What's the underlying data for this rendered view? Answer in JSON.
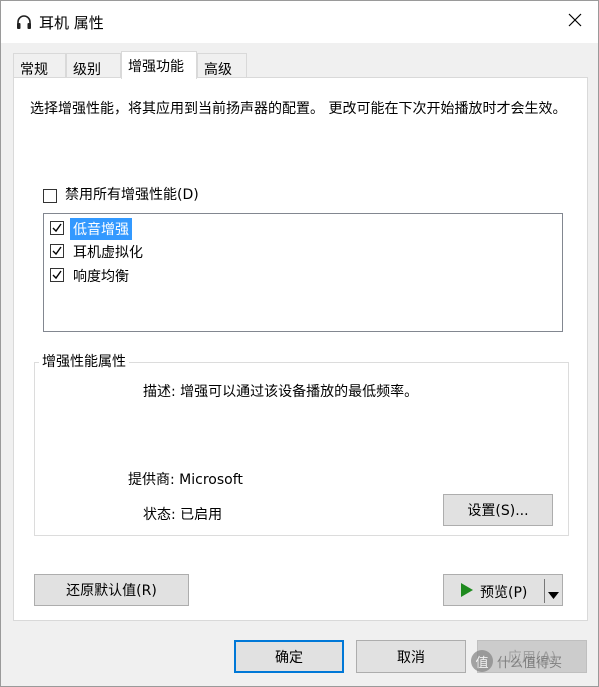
{
  "window": {
    "title": "耳机 属性"
  },
  "tabs": [
    {
      "label": "常规"
    },
    {
      "label": "级别"
    },
    {
      "label": "增强功能"
    },
    {
      "label": "高级"
    }
  ],
  "description": "选择增强性能，将其应用到当前扬声器的配置。 更改可能在下次开始播放时才会生效。",
  "disable_all": {
    "label": "禁用所有增强性能(D)",
    "checked": false
  },
  "enhancements": [
    {
      "label": "低音增强",
      "checked": true,
      "selected": true
    },
    {
      "label": "耳机虚拟化",
      "checked": true,
      "selected": false
    },
    {
      "label": "响度均衡",
      "checked": true,
      "selected": false
    }
  ],
  "properties": {
    "group_title": "增强性能属性",
    "description": "描述: 增强可以通过该设备播放的最低频率。",
    "provider": "提供商: Microsoft",
    "status": "状态: 已启用",
    "settings_button": "设置(S)..."
  },
  "buttons": {
    "restore_defaults": "还原默认值(R)",
    "preview": "预览(P)",
    "ok": "确定",
    "cancel": "取消",
    "apply": "应用(A)"
  },
  "watermark": "值 什么值得买",
  "colors": {
    "selection": "#3399ff",
    "default_button_border": "#0078d7",
    "play_icon": "#1e8a1e"
  }
}
